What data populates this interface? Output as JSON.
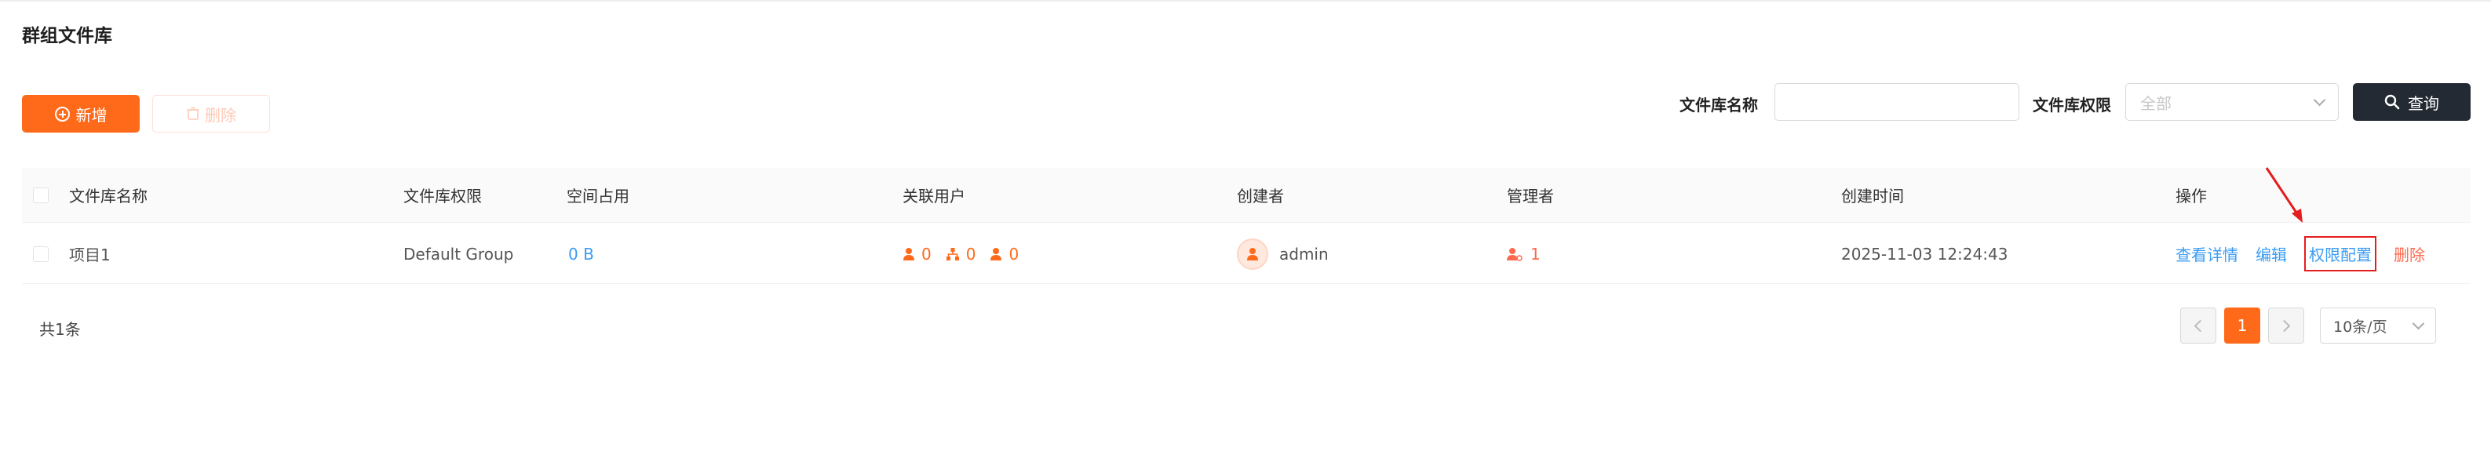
{
  "page": {
    "title": "群组文件库"
  },
  "toolbar": {
    "add_label": "新增",
    "delete_label": "删除"
  },
  "filters": {
    "name_label": "文件库名称",
    "name_value": "",
    "permission_label": "文件库权限",
    "permission_selected": "全部",
    "query_label": "查询"
  },
  "table": {
    "headers": [
      "文件库名称",
      "文件库权限",
      "空间占用",
      "关联用户",
      "创建者",
      "管理者",
      "创建时间",
      "操作"
    ],
    "rows": [
      {
        "name": "项目1",
        "permission": "Default Group",
        "space": "0 B",
        "users_count": "0",
        "orgs_count": "0",
        "groups_count": "0",
        "creator": "admin",
        "managers_count": "1",
        "created_at": "2025-11-03 12:24:43",
        "actions": [
          "查看详情",
          "编辑",
          "权限配置",
          "删除"
        ]
      }
    ]
  },
  "pagination": {
    "total_text": "共1条",
    "current_page": "1",
    "page_size": "10条/页"
  },
  "colors": {
    "accent": "#ff6a1a",
    "link": "#3a9cf2",
    "danger": "#ff6a4f",
    "dark": "#232a33",
    "highlight_box": "#e51d1d"
  },
  "icons": [
    "plus-circle-icon",
    "trash-icon",
    "chevron-down-icon",
    "search-icon",
    "user-icon",
    "org-icon",
    "manager-icon",
    "arrow-annotation-icon"
  ]
}
